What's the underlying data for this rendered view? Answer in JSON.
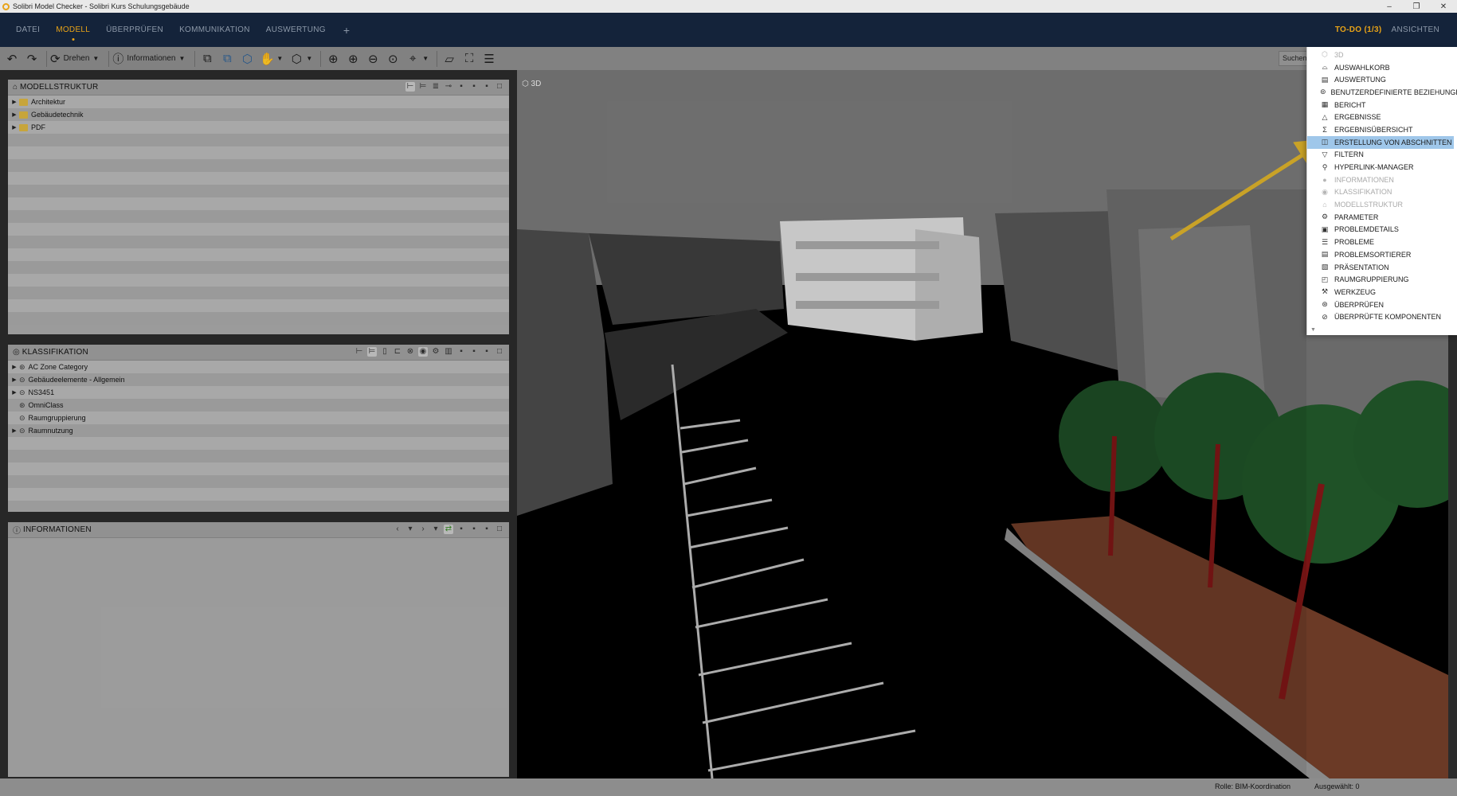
{
  "window": {
    "title": "Solibri Model Checker - Solibri Kurs Schulungsgebäude",
    "controls": [
      "–",
      "❐",
      "✕"
    ]
  },
  "menubar": {
    "tabs": [
      "DATEI",
      "MODELL",
      "ÜBERPRÜFEN",
      "KOMMUNIKATION",
      "AUSWERTUNG"
    ],
    "active_tab": "MODELL",
    "add": "+",
    "todo": "TO-DO (1/3)",
    "ansichten": "ANSICHTEN"
  },
  "toolbar": {
    "drehen": "Drehen",
    "informationen": "Informationen",
    "search_placeholder": "Suchen"
  },
  "modellstruktur": {
    "title": "MODELLSTRUKTUR",
    "items": [
      "Architektur",
      "Gebäudetechnik",
      "PDF"
    ]
  },
  "klassifikation": {
    "title": "KLASSIFIKATION",
    "items": [
      {
        "label": "AC Zone Category",
        "expandable": true
      },
      {
        "label": "Gebäudeelemente - Allgemein",
        "expandable": true
      },
      {
        "label": "NS3451",
        "expandable": true
      },
      {
        "label": "OmniClass",
        "expandable": false
      },
      {
        "label": "Raumgruppierung",
        "expandable": false
      },
      {
        "label": "Raumnutzung",
        "expandable": true
      }
    ]
  },
  "informationen": {
    "title": "INFORMATIONEN"
  },
  "viewport": {
    "label": "3D"
  },
  "statusbar": {
    "rolle": "Rolle: BIM-Koordination",
    "ausgewaehlt": "Ausgewählt: 0"
  },
  "dropdown": {
    "items": [
      {
        "label": "3D",
        "icon": "cube-icon",
        "disabled": true
      },
      {
        "label": "AUSWAHLKORB",
        "icon": "basket-icon",
        "disabled": false
      },
      {
        "label": "AUSWERTUNG",
        "icon": "report-icon",
        "disabled": false
      },
      {
        "label": "BENUTZERDEFINIERTE BEZIEHUNGEN",
        "icon": "relations-icon",
        "disabled": false
      },
      {
        "label": "BERICHT",
        "icon": "table-icon",
        "disabled": false
      },
      {
        "label": "ERGEBNISSE",
        "icon": "triangle-icon",
        "disabled": false
      },
      {
        "label": "ERGEBNISÜBERSICHT",
        "icon": "sigma-icon",
        "disabled": false
      },
      {
        "label": "ERSTELLUNG VON ABSCHNITTEN",
        "icon": "section-icon",
        "disabled": false,
        "highlight": true
      },
      {
        "label": "FILTERN",
        "icon": "filter-icon",
        "disabled": false
      },
      {
        "label": "HYPERLINK-MANAGER",
        "icon": "link-icon",
        "disabled": false
      },
      {
        "label": "INFORMATIONEN",
        "icon": "info-icon",
        "disabled": true
      },
      {
        "label": "KLASSIFIKATION",
        "icon": "classification-icon",
        "disabled": true
      },
      {
        "label": "MODELLSTRUKTUR",
        "icon": "structure-icon",
        "disabled": true
      },
      {
        "label": "PARAMETER",
        "icon": "gear-icon",
        "disabled": false
      },
      {
        "label": "PROBLEMDETAILS",
        "icon": "details-icon",
        "disabled": false
      },
      {
        "label": "PROBLEME",
        "icon": "list-icon",
        "disabled": false
      },
      {
        "label": "PROBLEMSORTIERER",
        "icon": "sorter-icon",
        "disabled": false
      },
      {
        "label": "PRÄSENTATION",
        "icon": "presentation-icon",
        "disabled": false
      },
      {
        "label": "RAUMGRUPPIERUNG",
        "icon": "room-icon",
        "disabled": false
      },
      {
        "label": "WERKZEUG",
        "icon": "tool-icon",
        "disabled": false
      },
      {
        "label": "ÜBERPRÜFEN",
        "icon": "check-icon",
        "disabled": false
      },
      {
        "label": "ÜBERPRÜFTE KOMPONENTEN",
        "icon": "checked-components-icon",
        "disabled": false
      }
    ]
  },
  "colors": {
    "accent": "#e8a317",
    "menubar_bg": "#14233a",
    "highlight": "#9fc7ea",
    "annotation_arrow": "#c9a227"
  }
}
